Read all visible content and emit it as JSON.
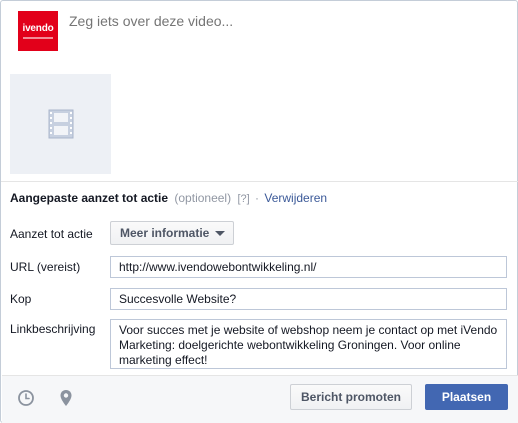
{
  "composer": {
    "brand_logo_text": "ivendo",
    "placeholder": "Zeg iets over deze video..."
  },
  "video": {
    "thumbnail_icon": "film-strip-icon"
  },
  "call_to_action": {
    "title": "Aangepaste aanzet tot actie",
    "optional_label": "(optioneel)",
    "help_label": "[?]",
    "separator": "·",
    "remove_link": "Verwijderen",
    "action_label": "Aanzet tot actie",
    "action_selected": "Meer informatie",
    "url_label": "URL (vereist)",
    "url_value": "http://www.ivendowebontwikkeling.nl/",
    "headline_label": "Kop",
    "headline_value": "Succesvolle Website?",
    "description_label": "Linkbeschrijving",
    "description_value": "Voor succes met je website of webshop neem je contact op met iVendo Marketing: doelgerichte webontwikkeling Groningen. Voor online marketing effect!"
  },
  "footer": {
    "icons": [
      "clock-icon",
      "location-pin-icon"
    ],
    "promote_label": "Bericht promoten",
    "post_label": "Plaatsen"
  },
  "colors": {
    "brand_red": "#e2001a",
    "link_blue": "#3b5998",
    "primary_button": "#4267b2"
  }
}
